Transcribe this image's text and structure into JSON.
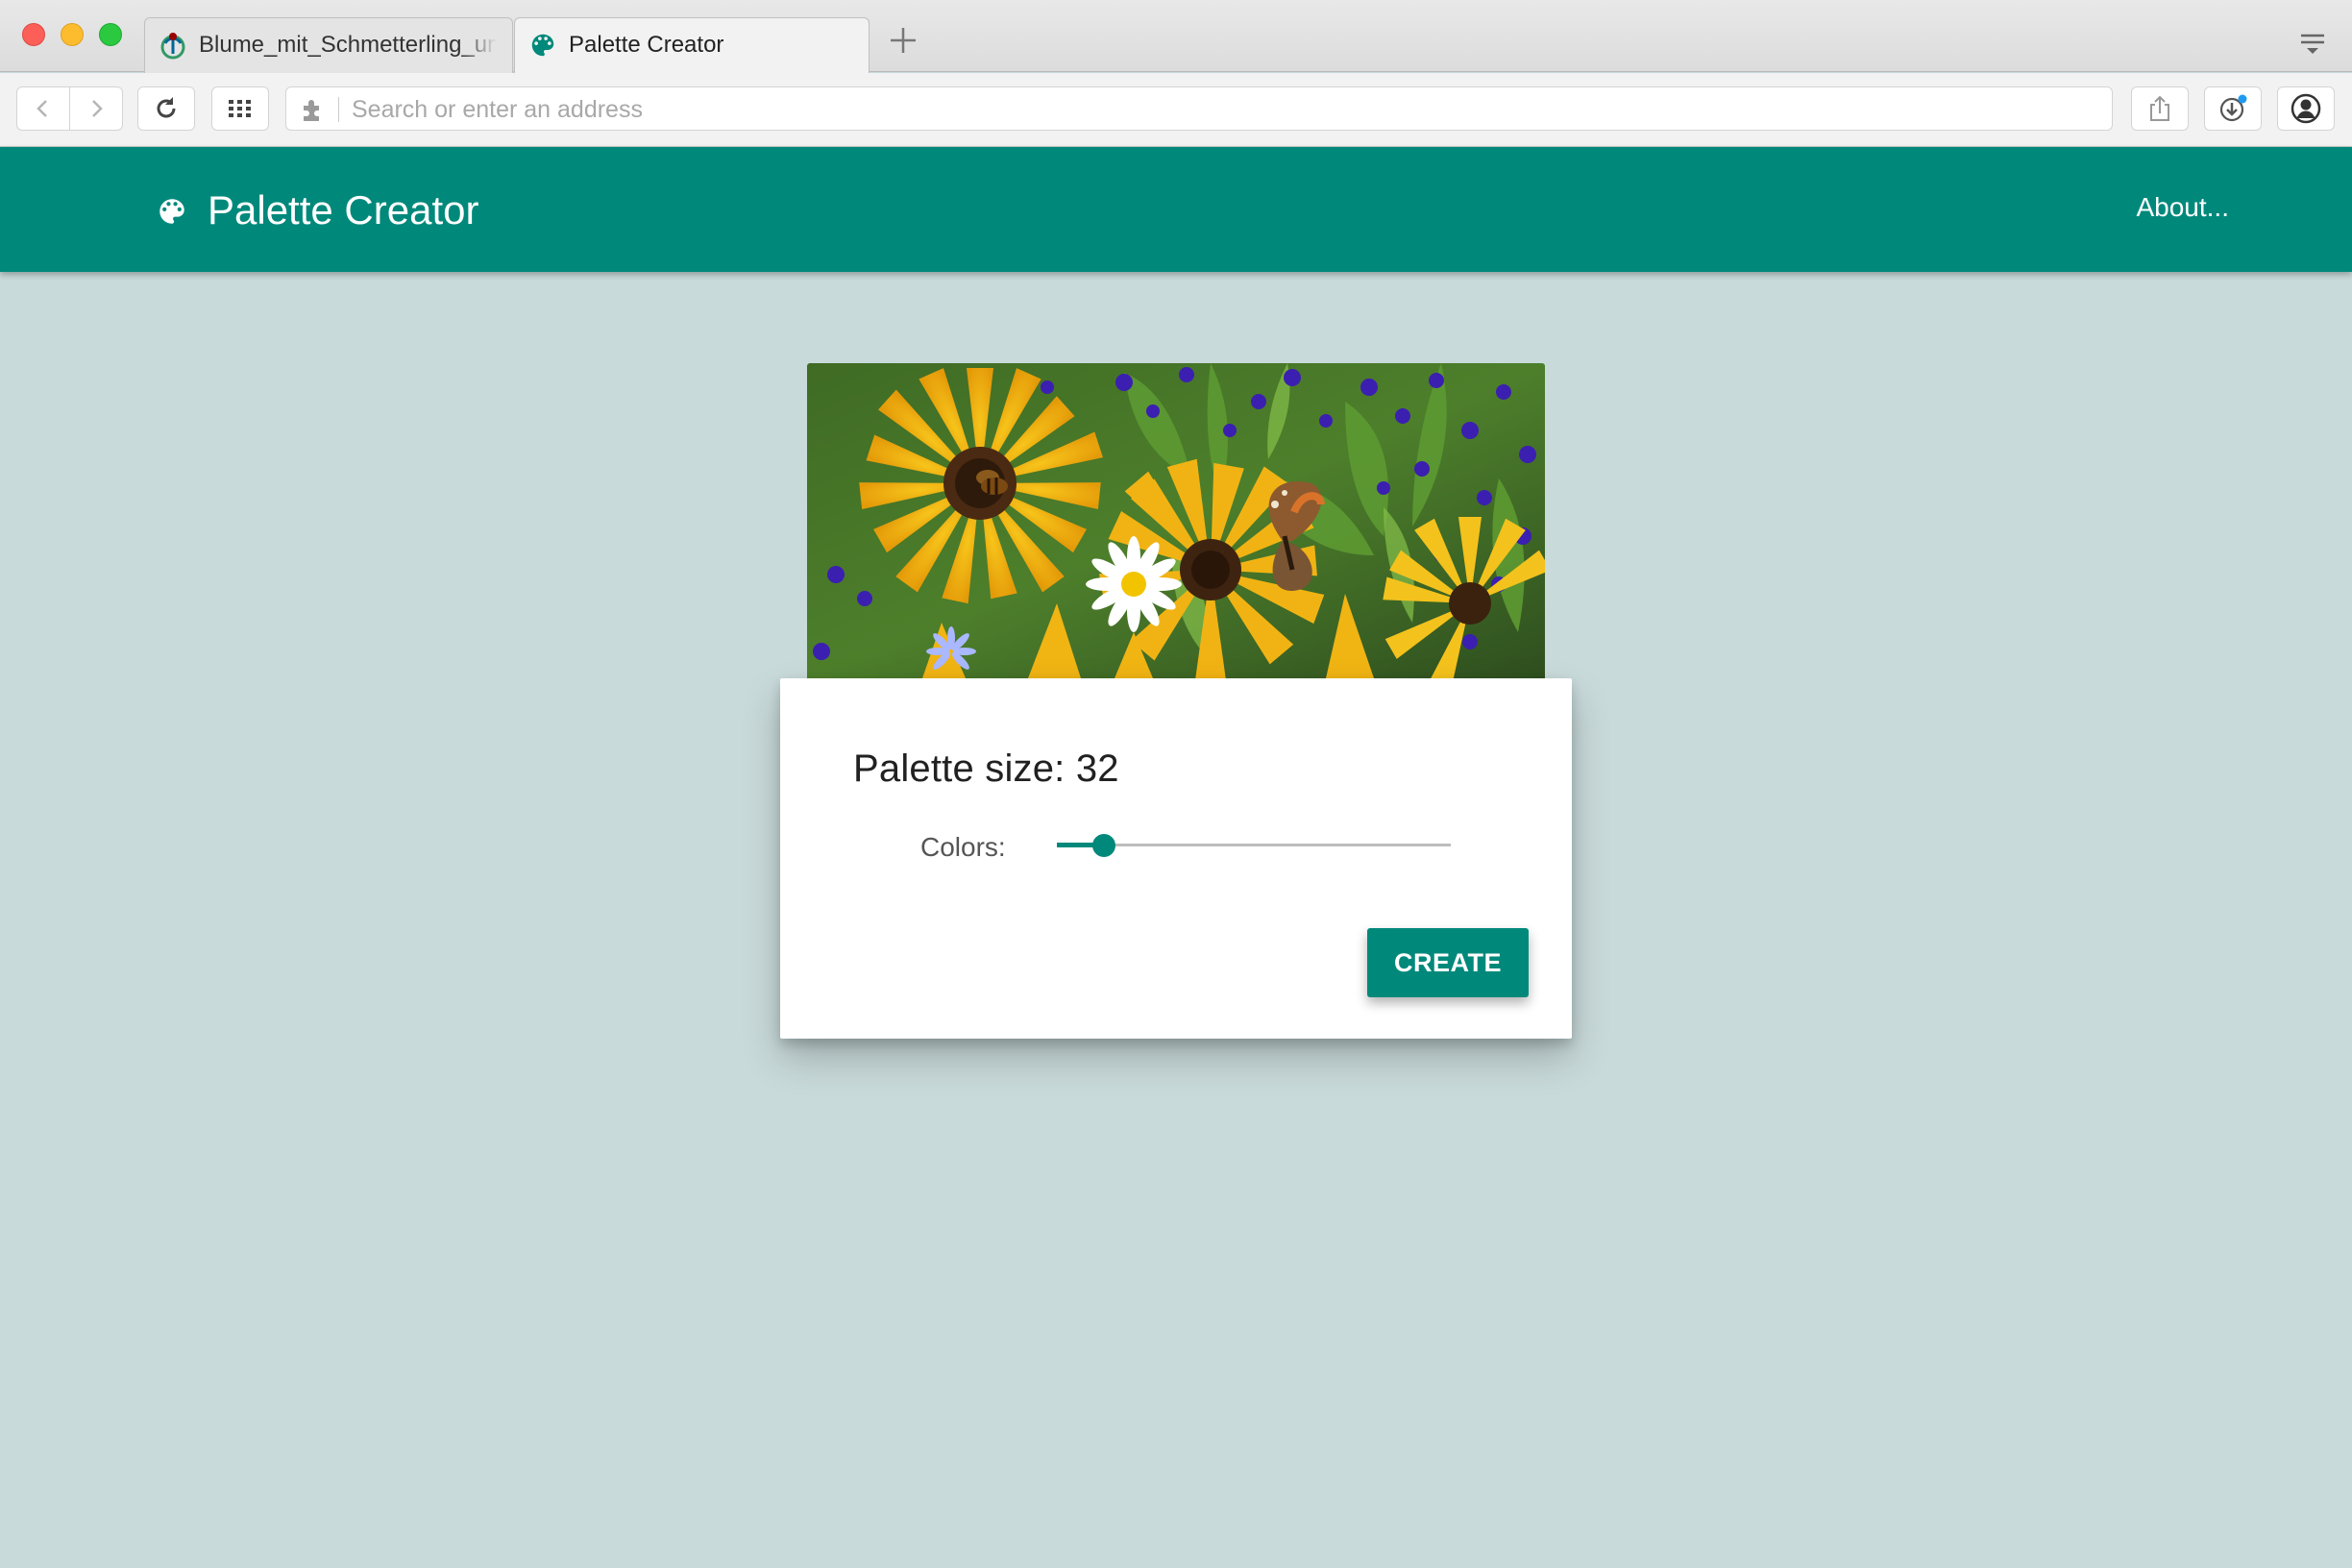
{
  "browser": {
    "tabs": [
      {
        "title": "Blume_mit_Schmetterling_und_Biene",
        "active": false,
        "icon": "wikimedia-icon"
      },
      {
        "title": "Palette Creator",
        "active": true,
        "icon": "palette-icon"
      }
    ],
    "address_placeholder": "Search or enter an address",
    "icons": [
      "back-icon",
      "forward-icon",
      "reload-icon",
      "speed-dial-icon",
      "extension-icon",
      "share-icon",
      "download-icon",
      "account-icon",
      "tab-menu-icon",
      "new-tab-icon"
    ]
  },
  "app": {
    "title": "Palette Creator",
    "about_label": "About...",
    "brand_color": "#00897b",
    "background_color": "#c9dada"
  },
  "card": {
    "title_prefix": "Palette size:",
    "palette_size": "32",
    "colors_label": "Colors:",
    "slider_fraction": 0.12,
    "create_label": "CREATE"
  }
}
